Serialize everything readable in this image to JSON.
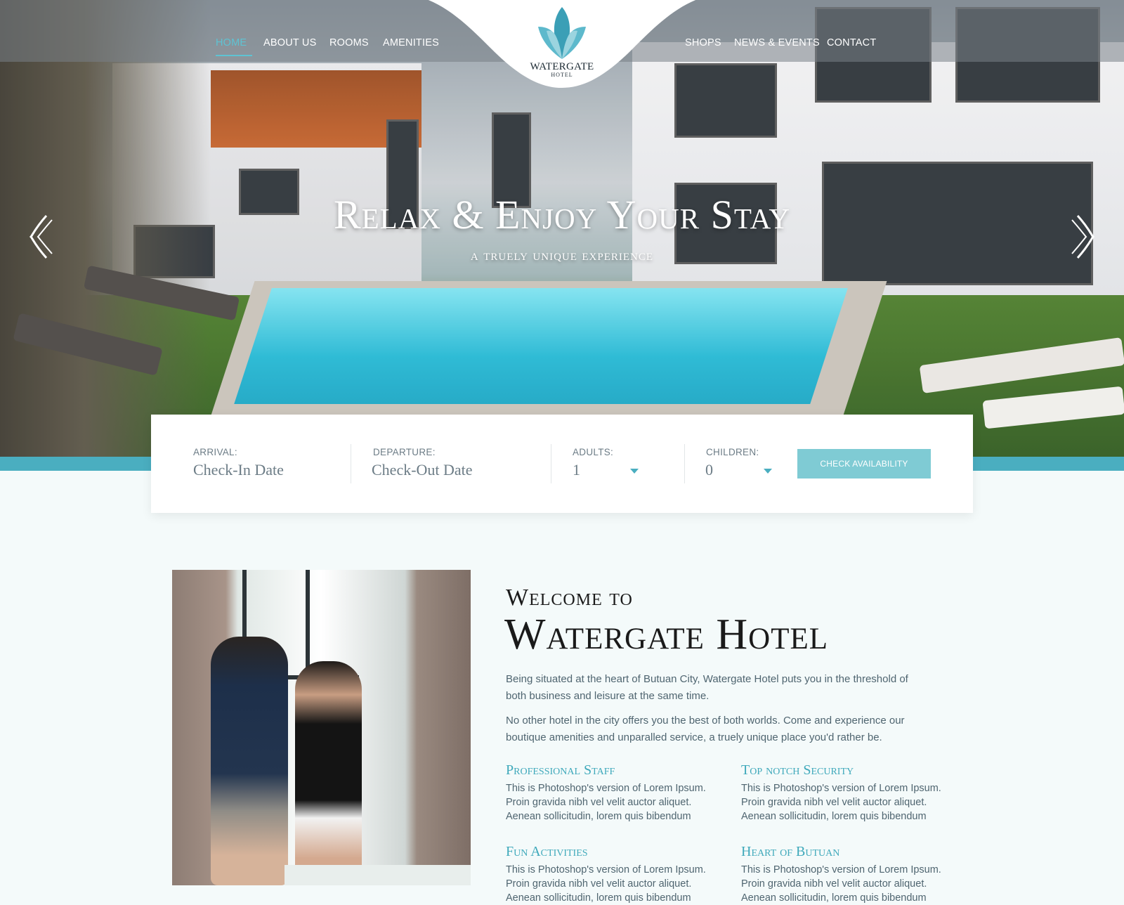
{
  "nav": {
    "left": [
      "HOME",
      "ABOUT US",
      "ROOMS",
      "AMENITIES"
    ],
    "right": [
      "SHOPS",
      "NEWS & EVENTS",
      "CONTACT"
    ],
    "active": "HOME"
  },
  "logo": {
    "name": "WATERGATE",
    "sub": "HOTEL",
    "icon": "lotus-icon"
  },
  "hero": {
    "title": "Relax & Enjoy Your Stay",
    "subtitle": "a truely unique experience",
    "prev_icon": "chevron-left-icon",
    "next_icon": "chevron-right-icon"
  },
  "booking": {
    "arrival_label": "ARRIVAL:",
    "arrival_placeholder": "Check-In Date",
    "departure_label": "DEPARTURE:",
    "departure_placeholder": "Check-Out Date",
    "adults_label": "ADULTS:",
    "adults_value": "1",
    "children_label": "CHILDREN:",
    "children_value": "0",
    "button": "CHECK AVAILABILITY"
  },
  "welcome": {
    "small": "Welcome to",
    "big": "Watergate Hotel",
    "p1": "Being situated at the heart of Butuan City, Watergate Hotel puts you in the threshold of both business and leisure at the same time.",
    "p2": "No other hotel in the city offers you the best of both worlds. Come and experience our boutique amenities and unparalled service, a truely unique place you'd rather be."
  },
  "features": [
    {
      "title": "Professional Staff",
      "text": "This is Photoshop's version  of Lorem Ipsum. Proin gravida nibh vel velit auctor aliquet. Aenean sollicitudin, lorem quis bibendum"
    },
    {
      "title": "Top notch Security",
      "text": "This is Photoshop's version  of Lorem Ipsum. Proin gravida nibh vel velit auctor aliquet. Aenean sollicitudin, lorem quis bibendum"
    },
    {
      "title": "Fun Activities",
      "text": "This is Photoshop's version  of Lorem Ipsum. Proin gravida nibh vel velit auctor aliquet. Aenean sollicitudin, lorem quis bibendum"
    },
    {
      "title": "Heart of Butuan",
      "text": "This is Photoshop's version  of Lorem Ipsum. Proin gravida nibh vel velit auctor aliquet. Aenean sollicitudin, lorem quis bibendum"
    }
  ],
  "colors": {
    "accent": "#4aaec0",
    "button": "#7fcbd4",
    "heading": "#3fa9bb",
    "text": "#4f6570"
  }
}
